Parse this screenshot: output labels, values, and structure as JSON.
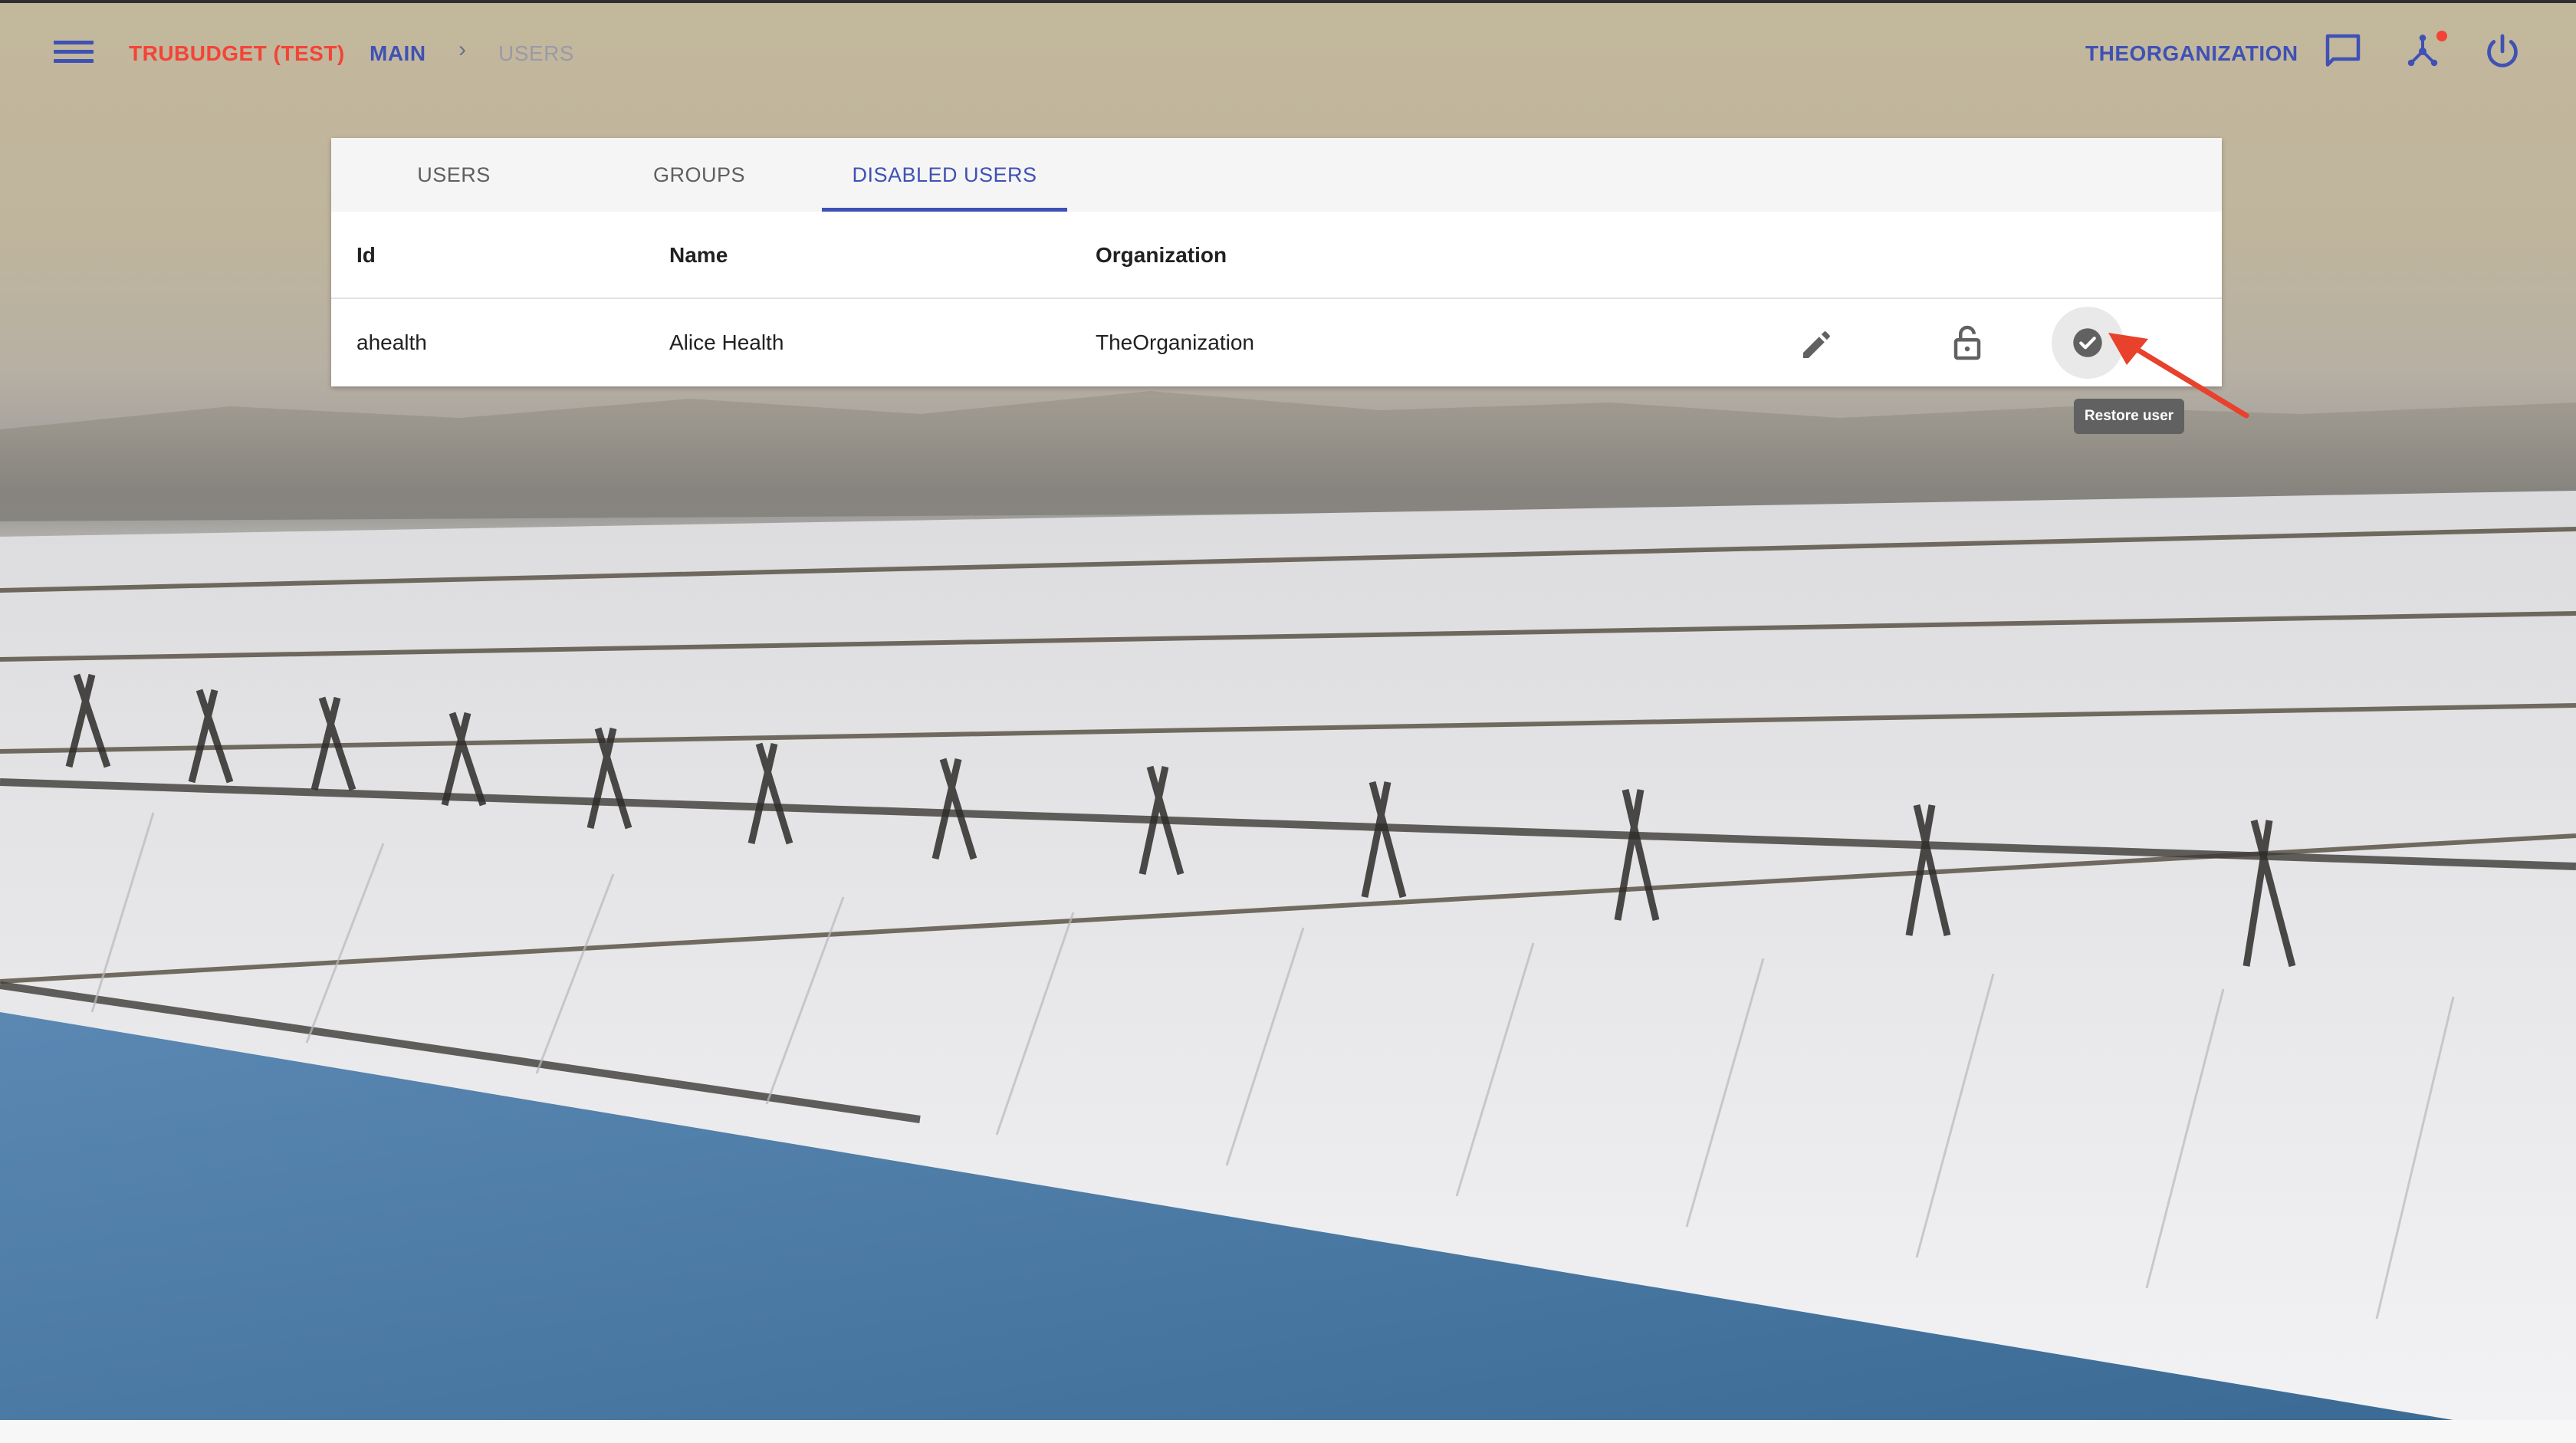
{
  "appbar": {
    "brand": "TRUBUDGET (TEST)",
    "breadcrumb_main": "MAIN",
    "breadcrumb_separator": "›",
    "breadcrumb_current": "USERS",
    "organization": "THEORGANIZATION",
    "icons": [
      "menu-icon",
      "message-icon",
      "network-icon",
      "power-icon"
    ],
    "notification_color": "#f44336",
    "accent_color": "#3f51b5"
  },
  "tabs": [
    {
      "label": "USERS",
      "active": false
    },
    {
      "label": "GROUPS",
      "active": false
    },
    {
      "label": "DISABLED USERS",
      "active": true
    }
  ],
  "table": {
    "columns": [
      "Id",
      "Name",
      "Organization"
    ],
    "rows": [
      {
        "id": "ahealth",
        "name": "Alice Health",
        "organization": "TheOrganization",
        "actions": [
          "edit-icon",
          "lock-open-icon",
          "check-circle-icon"
        ]
      }
    ]
  },
  "tooltip": {
    "text": "Restore user"
  },
  "annotation": {
    "arrow_color": "#e8412c"
  }
}
